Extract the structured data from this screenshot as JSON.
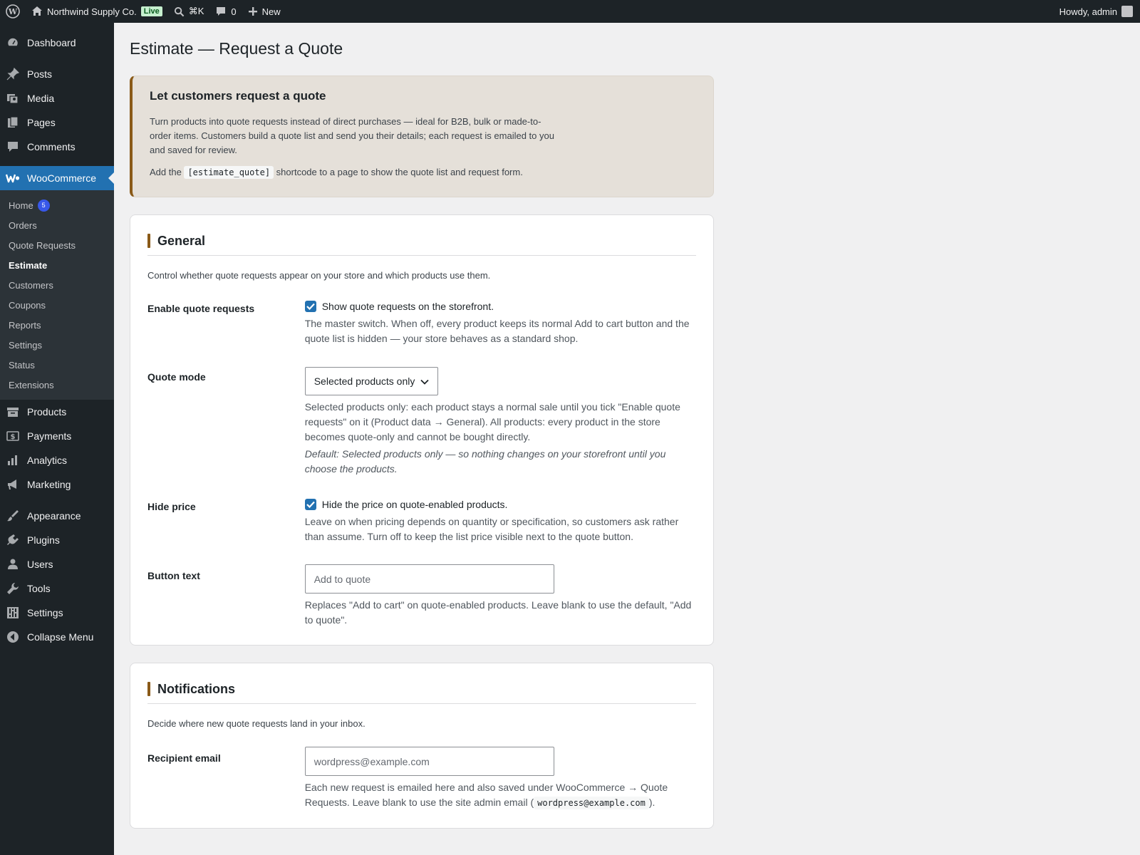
{
  "adminbar": {
    "site_name": "Northwind Supply Co.",
    "live_badge": "Live",
    "search_shortcut": "⌘K",
    "comments_count": "0",
    "new_label": "New",
    "howdy": "Howdy, admin"
  },
  "sidebar": {
    "dashboard": "Dashboard",
    "posts": "Posts",
    "media": "Media",
    "pages": "Pages",
    "comments": "Comments",
    "woocommerce": "WooCommerce",
    "woo_sub": {
      "home": "Home",
      "home_badge": "5",
      "orders": "Orders",
      "quote_requests": "Quote Requests",
      "estimate": "Estimate",
      "customers": "Customers",
      "coupons": "Coupons",
      "reports": "Reports",
      "settings": "Settings",
      "status": "Status",
      "extensions": "Extensions"
    },
    "products": "Products",
    "payments": "Payments",
    "analytics": "Analytics",
    "marketing": "Marketing",
    "appearance": "Appearance",
    "plugins": "Plugins",
    "users": "Users",
    "tools": "Tools",
    "settings": "Settings",
    "collapse": "Collapse Menu"
  },
  "page": {
    "title": "Estimate — Request a Quote"
  },
  "notice": {
    "heading": "Let customers request a quote",
    "body": "Turn products into quote requests instead of direct purchases — ideal for B2B, bulk or made-to-order items. Customers build a quote list and send you their details; each request is emailed to you and saved for review.",
    "shortcode_pre": "Add the",
    "shortcode": "[estimate_quote]",
    "shortcode_post": "shortcode to a page to show the quote list and request form."
  },
  "general": {
    "heading": "General",
    "description": "Control whether quote requests appear on your store and which products use them.",
    "enable": {
      "label": "Enable quote requests",
      "checkbox_label": "Show quote requests on the storefront.",
      "help": "The master switch. When off, every product keeps its normal Add to cart button and the quote list is hidden — your store behaves as a standard shop."
    },
    "mode": {
      "label": "Quote mode",
      "selected": "Selected products only",
      "help": "Selected products only: each product stays a normal sale until you tick \"Enable quote requests\" on it (Product data → General). All products: every product in the store becomes quote-only and cannot be bought directly.",
      "default_note": "Default: Selected products only — so nothing changes on your storefront until you choose the products."
    },
    "hide_price": {
      "label": "Hide price",
      "checkbox_label": "Hide the price on quote-enabled products.",
      "help": "Leave on when pricing depends on quantity or specification, so customers ask rather than assume. Turn off to keep the list price visible next to the quote button."
    },
    "button_text": {
      "label": "Button text",
      "placeholder": "Add to quote",
      "help": "Replaces \"Add to cart\" on quote-enabled products. Leave blank to use the default, \"Add to quote\"."
    }
  },
  "notifications": {
    "heading": "Notifications",
    "description": "Decide where new quote requests land in your inbox.",
    "recipient": {
      "label": "Recipient email",
      "placeholder": "wordpress@example.com",
      "help_pre": "Each new request is emailed here and also saved under WooCommerce → Quote Requests. Leave blank to use the site admin email (",
      "help_code": "wordpress@example.com",
      "help_post": ")."
    }
  },
  "colors": {
    "accent": "#2271b1",
    "brand_bar": "#8a5a18",
    "sidebar_bg": "#1d2327"
  }
}
